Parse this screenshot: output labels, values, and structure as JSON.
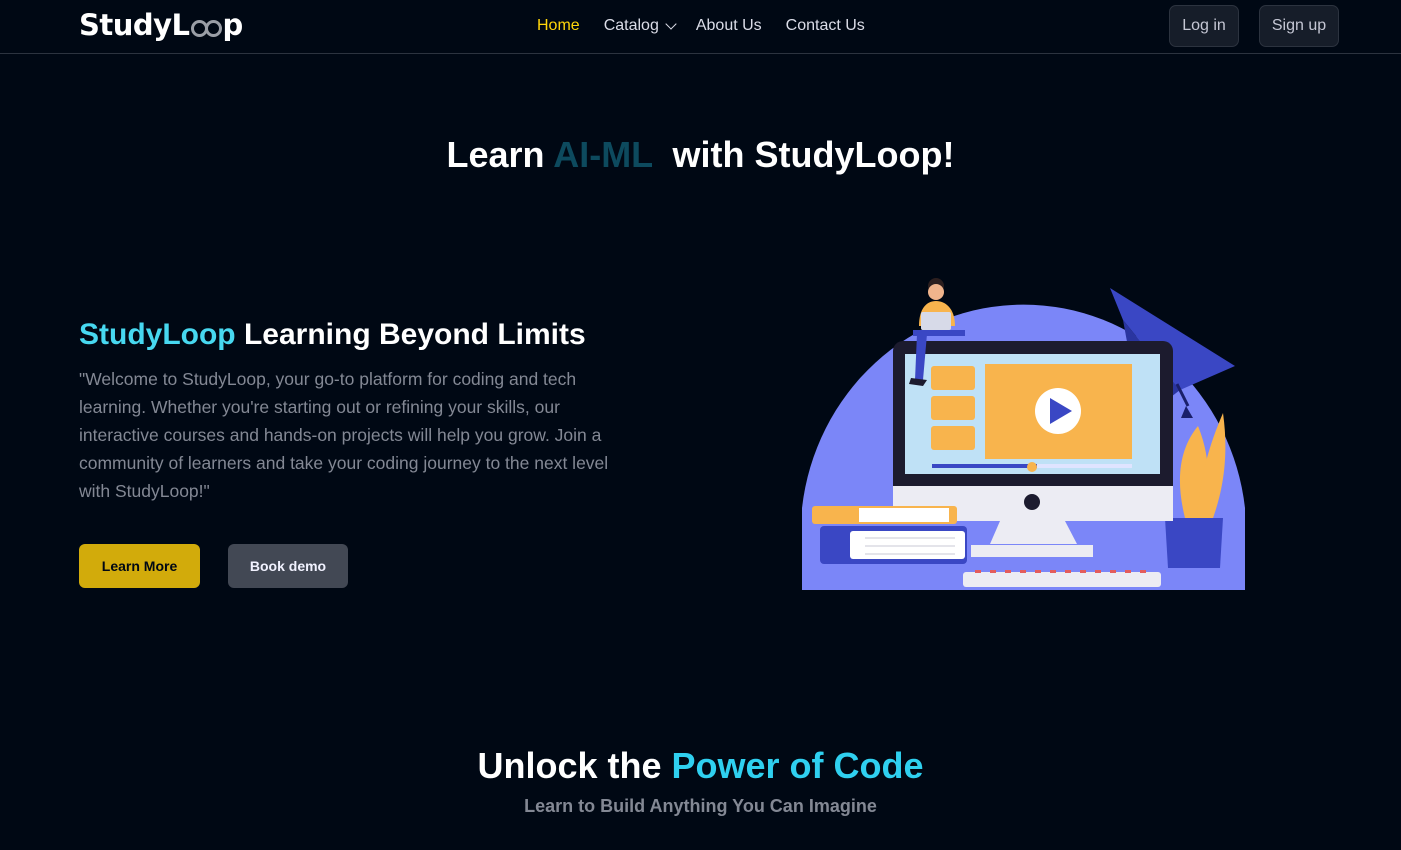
{
  "navbar": {
    "logo_text_start": "StudyL",
    "logo_text_end": "p",
    "links": [
      {
        "label": "Home",
        "active": true
      },
      {
        "label": "Catalog",
        "has_dropdown": true
      },
      {
        "label": "About Us"
      },
      {
        "label": "Contact Us"
      }
    ],
    "login_label": "Log in",
    "signup_label": "Sign up"
  },
  "hero": {
    "title_prefix": "Learn ",
    "title_accent": "AI-ML",
    "title_suffix": "  with StudyLoop!"
  },
  "intro": {
    "heading_accent": "StudyLoop",
    "heading_rest": " Learning Beyond Limits",
    "description": "\"Welcome to StudyLoop, your go-to platform for coding and tech learning. Whether you're starting out or refining your skills, our interactive courses and hands-on projects will help you grow. Join a community of learners and take your coding journey to the next level with StudyLoop!\"",
    "learn_more_label": "Learn More",
    "book_demo_label": "Book demo"
  },
  "section2": {
    "title_prefix": "Unlock the ",
    "title_accent": "Power of Code",
    "subtitle": "Learn to Build Anything You Can Imagine"
  },
  "colors": {
    "background": "#000814",
    "accent_yellow": "#ffd60a",
    "accent_cyan": "#47d8f0",
    "button_yellow": "#d2ab0b",
    "illustration_blue": "#7b86f8"
  },
  "icons": [
    "chevron-down-icon",
    "play-icon",
    "graduation-cap-icon"
  ]
}
